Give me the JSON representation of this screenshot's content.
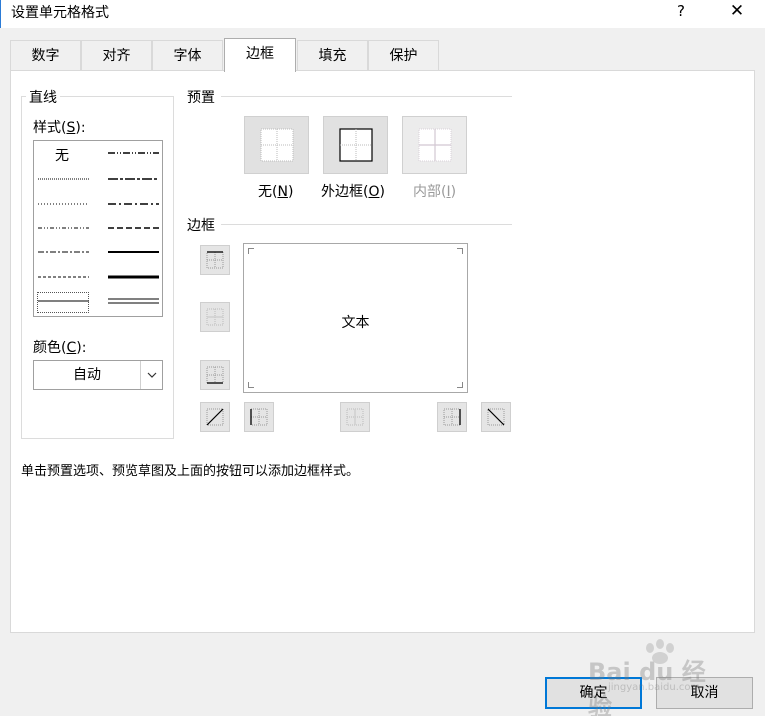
{
  "window": {
    "title": "设置单元格格式",
    "help_glyph": "?",
    "close_glyph": "✕"
  },
  "tabs": [
    {
      "label": "数字",
      "active": false
    },
    {
      "label": "对齐",
      "active": false
    },
    {
      "label": "字体",
      "active": false
    },
    {
      "label": "边框",
      "active": true
    },
    {
      "label": "填充",
      "active": false
    },
    {
      "label": "保护",
      "active": false
    }
  ],
  "line_group": {
    "title": "直线",
    "style_label": "样式",
    "style_hotkey": "S",
    "style_none": "无",
    "color_label": "颜色",
    "color_hotkey": "C",
    "color_value": "自动"
  },
  "presets": {
    "title": "预置",
    "items": [
      {
        "label": "无",
        "hotkey": "N",
        "enabled": true
      },
      {
        "label": "外边框",
        "hotkey": "O",
        "enabled": true
      },
      {
        "label": "内部",
        "hotkey": "I",
        "enabled": false
      }
    ]
  },
  "border": {
    "title": "边框",
    "preview_text": "文本"
  },
  "hint": "单击预置选项、预览草图及上面的按钮可以添加边框样式。",
  "buttons": {
    "ok": "确定",
    "cancel": "取消"
  },
  "watermark": {
    "brand": "Bai du 经验",
    "url": "jingyan.baidu.com"
  },
  "colors": {
    "accent": "#0078d7",
    "panel": "#ffffff",
    "dialog_bg": "#f0f0f0",
    "disabled_text": "#9a9a9a"
  }
}
